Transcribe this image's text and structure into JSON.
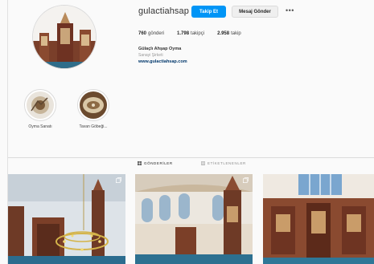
{
  "profile": {
    "username": "gulactiahsap",
    "follow_label": "Takip Et",
    "message_label": "Mesaj Gönder",
    "stats": [
      {
        "value": "760",
        "label": "gönderi"
      },
      {
        "value": "1.798",
        "label": "takipçi"
      },
      {
        "value": "2.958",
        "label": "takip"
      }
    ],
    "full_name": "Gülaçlı Ahşap Oyma",
    "category": "Sanayi Şirketi",
    "website": "www.gulactiahsap.com"
  },
  "highlights": [
    {
      "label": "Oyma Sanatı"
    },
    {
      "label": "Tavan Göbeği..."
    }
  ],
  "tabs": [
    {
      "label": "GÖNDERİLER"
    },
    {
      "label": "ETİKETLENENLER"
    }
  ],
  "icons": {
    "more": "more-options-icon",
    "posts_tab": "grid-icon",
    "tagged_tab": "tagged-icon",
    "multi_photo": "carousel-icon"
  },
  "colors": {
    "follow_button": "#0095f6",
    "link": "#00376b",
    "background": "#fafafa"
  }
}
